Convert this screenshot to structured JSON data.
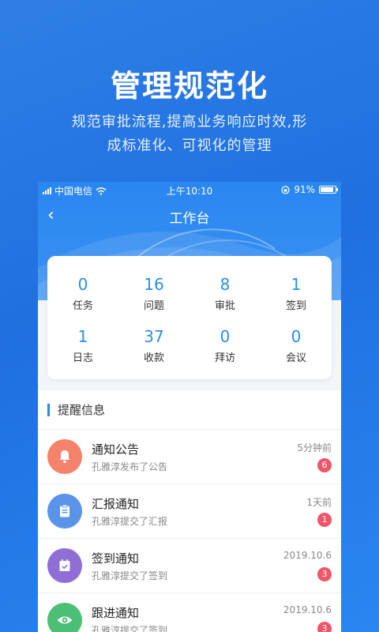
{
  "hero": {
    "title": "管理规范化",
    "subtitle_line1": "规范审批流程,提高业务响应时效,形",
    "subtitle_line2": "成标准化、可视化的管理"
  },
  "statusbar": {
    "carrier": "中国电信",
    "time": "上午10:10",
    "battery": "91%",
    "battery_level": 0.91
  },
  "navbar": {
    "title": "工作台",
    "back_icon": "chevron-left-icon"
  },
  "stats": [
    {
      "value": "0",
      "label": "任务"
    },
    {
      "value": "16",
      "label": "问题"
    },
    {
      "value": "8",
      "label": "审批"
    },
    {
      "value": "1",
      "label": "签到"
    },
    {
      "value": "1",
      "label": "日志"
    },
    {
      "value": "37",
      "label": "收款"
    },
    {
      "value": "0",
      "label": "拜访"
    },
    {
      "value": "0",
      "label": "会议"
    }
  ],
  "reminders": {
    "title": "提醒信息",
    "items": [
      {
        "title": "通知公告",
        "desc": "孔雅淳发布了公告",
        "time": "5分钟前",
        "badge": "6",
        "icon": "bell-icon",
        "color": "#f5826a"
      },
      {
        "title": "汇报通知",
        "desc": "孔雅淳提交了汇报",
        "time": "1天前",
        "badge": "1",
        "icon": "clipboard-icon",
        "color": "#5a94e8"
      },
      {
        "title": "签到通知",
        "desc": "孔雅淳提交了签到",
        "time": "2019.10.6",
        "badge": "3",
        "icon": "calendar-check-icon",
        "color": "#8f6fd6"
      },
      {
        "title": "跟进通知",
        "desc": "孔雅淳提交了签到",
        "time": "2019.10.6",
        "badge": "3",
        "icon": "eye-icon",
        "color": "#4bbf73"
      }
    ]
  },
  "colors": {
    "accent": "#2a86f0",
    "stat_value": "#2a8ee8",
    "badge": "#f0556a"
  }
}
